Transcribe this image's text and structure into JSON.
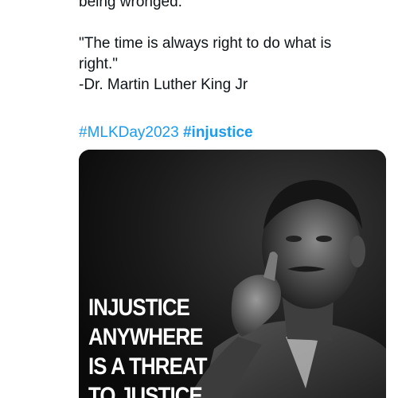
{
  "tweet": {
    "lines": [
      "being wronged.",
      "",
      "\"The time is always right to do what is",
      "right.\"",
      "-Dr. Martin Luther King Jr"
    ],
    "hashtags": [
      {
        "text": "#MLKDay2023",
        "bold": false
      },
      {
        "text": "#injustice",
        "bold": true
      }
    ],
    "link_color": "#1d9bf0"
  },
  "media": {
    "overlay_lines": [
      "INJUSTICE",
      "ANYWHERE",
      "IS A THREAT",
      "TO JUSTICE"
    ]
  }
}
